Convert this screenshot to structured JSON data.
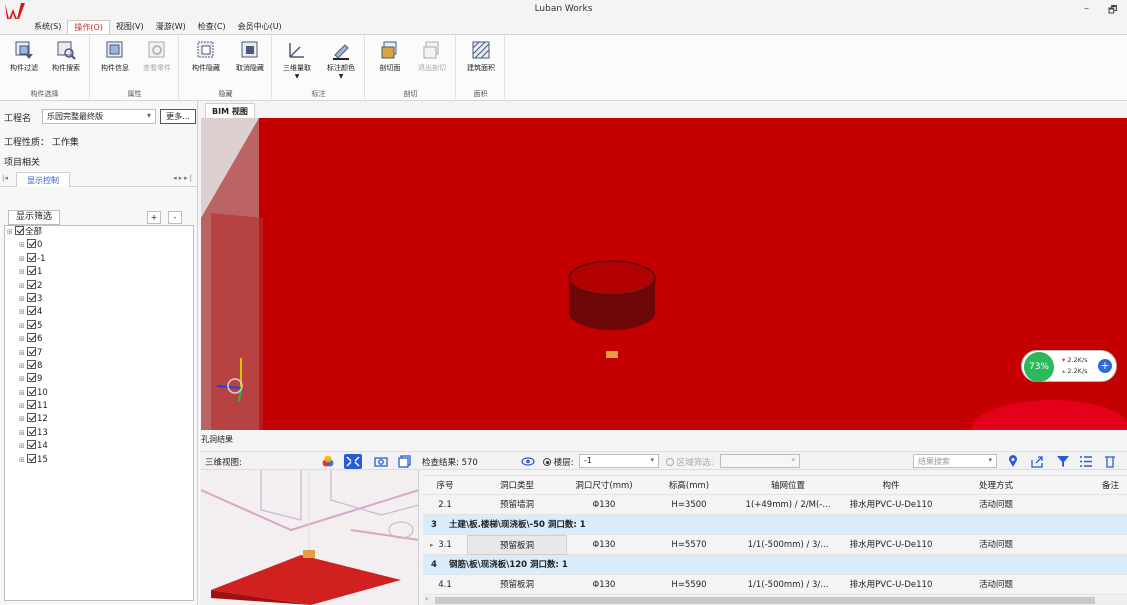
{
  "app": {
    "title": "Luban Works",
    "minimize_glyph": "–",
    "restore_glyph": "🗗"
  },
  "menu": [
    {
      "label": "系统(S)",
      "active": false
    },
    {
      "label": "操作(O)",
      "active": true
    },
    {
      "label": "视图(V)",
      "active": false
    },
    {
      "label": "漫游(W)",
      "active": false
    },
    {
      "label": "检查(C)",
      "active": false
    },
    {
      "label": "会员中心(U)",
      "active": false
    }
  ],
  "ribbon": {
    "groups": [
      {
        "label": "构件选择",
        "buttons": [
          {
            "label": "构件过滤",
            "icon": "component-filter-icon"
          },
          {
            "label": "构件搜索",
            "icon": "component-search-icon"
          }
        ]
      },
      {
        "label": "属性",
        "buttons": [
          {
            "label": "构件信息",
            "icon": "component-info-icon"
          },
          {
            "label": "查看零件",
            "icon": "view-parts-icon",
            "disabled": true
          }
        ]
      },
      {
        "label": "隐藏",
        "buttons": [
          {
            "label": "构件隐藏",
            "icon": "hide-component-icon"
          },
          {
            "label": "取消隐藏",
            "icon": "unhide-icon"
          }
        ]
      },
      {
        "label": "标注",
        "buttons": [
          {
            "label": "三维量取",
            "icon": "3d-measure-icon"
          },
          {
            "label": "标注颜色",
            "icon": "annotation-color-icon"
          }
        ]
      },
      {
        "label": "剖切",
        "buttons": [
          {
            "label": "剖切面",
            "icon": "section-plane-icon"
          },
          {
            "label": "退出剖切",
            "icon": "exit-section-icon",
            "disabled": true
          }
        ]
      },
      {
        "label": "面积",
        "buttons": [
          {
            "label": "建筑面积",
            "icon": "building-area-icon"
          }
        ]
      }
    ]
  },
  "left_panel": {
    "project_label": "工程名",
    "project_value": "乐园完整最终版",
    "more_button": "更多...",
    "nature_label": "工程性质：",
    "nature_value": "工作集",
    "related_label": "项目相关",
    "tab": "显示控制",
    "filter_button": "显示筛选",
    "plus": "+",
    "minus": "-",
    "tree": [
      "全部",
      "0",
      "-1",
      "1",
      "2",
      "3",
      "4",
      "5",
      "6",
      "7",
      "8",
      "9",
      "10",
      "11",
      "12",
      "13",
      "14",
      "15"
    ]
  },
  "viewport": {
    "tab": "BIM 视图",
    "net_widget": {
      "percent": "73%",
      "up": "2.2K/s",
      "down": "2.2K/s",
      "level": 0.73
    }
  },
  "results": {
    "title": "孔洞结果",
    "preview_label": "三维视图:",
    "count_text": "检查结果: 570",
    "floor_label": "楼层:",
    "floor_value": "-1",
    "region_label": "区域筛选:",
    "search_placeholder": "结果搜索",
    "columns": [
      "序号",
      "洞口类型",
      "洞口尺寸(mm)",
      "标高(mm)",
      "轴网位置",
      "构件",
      "处理方式",
      "备注"
    ],
    "rows": [
      {
        "kind": "data",
        "no": "2.1",
        "type": "预留墙洞",
        "size": "Φ130",
        "elev": "H=3500",
        "axis": "1(+49mm) / 2/M(-...",
        "comp": "排水用PVC-U-De110",
        "handle": "活动问题",
        "note": ""
      },
      {
        "kind": "group",
        "no": "3",
        "text": "土建\\板.楼梯\\现浇板\\-50  洞口数: 1"
      },
      {
        "kind": "data",
        "no": "3.1",
        "type": "预留板洞",
        "size": "Φ130",
        "elev": "H=5570",
        "axis": "1/1(-500mm) / 3/...",
        "comp": "排水用PVC-U-De110",
        "handle": "活动问题",
        "note": "",
        "selected": true
      },
      {
        "kind": "group",
        "no": "4",
        "text": "钢筋\\板\\现浇板\\120  洞口数: 1"
      },
      {
        "kind": "data",
        "no": "4.1",
        "type": "预留板洞",
        "size": "Φ130",
        "elev": "H=5590",
        "axis": "1/1(-500mm) / 3/...",
        "comp": "排水用PVC-U-De110",
        "handle": "活动问题",
        "note": ""
      }
    ]
  },
  "colors": {
    "accent": "#d02a2a",
    "viewport_red": "#c00000",
    "group_row": "#d9ecfb",
    "link_blue": "#2a5bd7"
  }
}
